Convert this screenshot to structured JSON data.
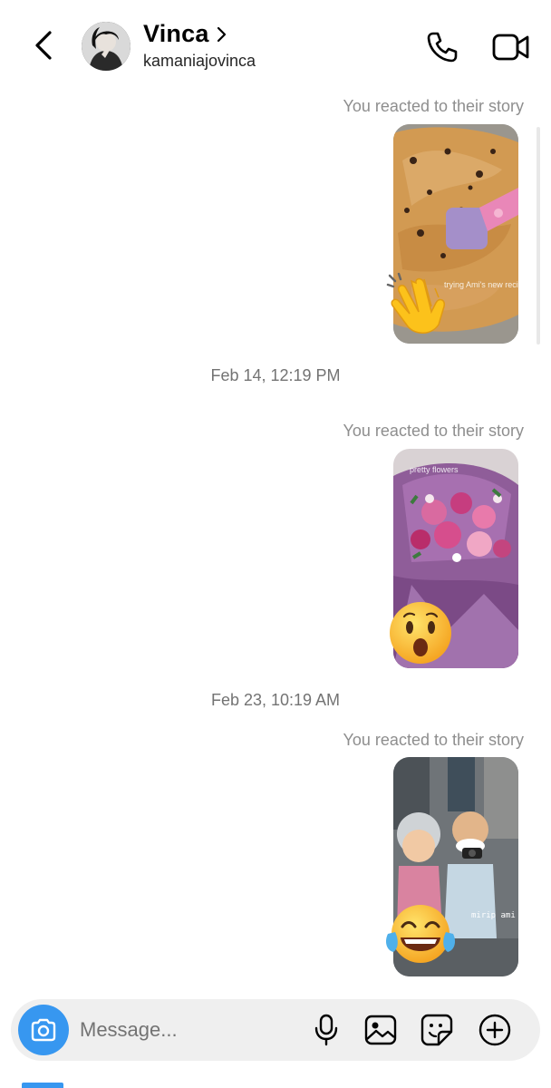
{
  "header": {
    "back_icon": "chevron-left-icon",
    "name": "Vinca",
    "username": "kamaniajovinca",
    "call_icon": "phone-icon",
    "video_icon": "video-camera-icon"
  },
  "thread": {
    "items": [
      {
        "reaction_label": "You reacted to their story",
        "reaction_emoji": "clapping-hands",
        "story_caption": "trying Ami's new recipe"
      },
      {
        "timestamp": "Feb 14, 12:19 PM"
      },
      {
        "reaction_label": "You reacted to their story",
        "reaction_emoji": "face-with-open-mouth",
        "story_caption": "pretty flowers"
      },
      {
        "timestamp": "Feb 23, 10:19 AM"
      },
      {
        "reaction_label": "You reacted to their story",
        "reaction_emoji": "face-with-tears-of-joy",
        "story_caption": "mirip ami ♥"
      }
    ]
  },
  "composer": {
    "placeholder": "Message...",
    "camera_icon": "camera-icon",
    "mic_icon": "microphone-icon",
    "gallery_icon": "image-icon",
    "sticker_icon": "sticker-icon",
    "plus_icon": "plus-circle-icon"
  },
  "colors": {
    "accent": "#3797f0",
    "muted_text": "#8e8e8e",
    "timestamp_text": "#737373",
    "composer_bg": "#efefef"
  }
}
